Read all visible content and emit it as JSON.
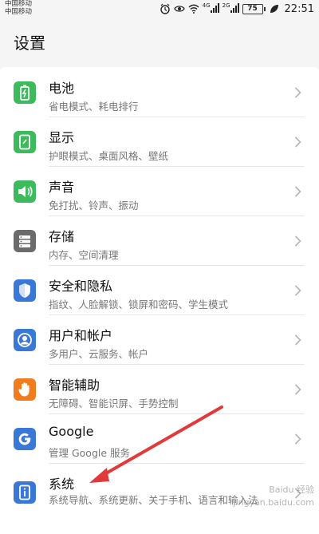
{
  "status_bar": {
    "carrier_1": "中国移动",
    "carrier_2": "中国移动",
    "signal_1_label": "4G",
    "signal_2_label": "2G",
    "battery": "75",
    "time": "22:51"
  },
  "page_title": "设置",
  "items": [
    {
      "title": "电池",
      "subtitle": "省电模式、耗电排行",
      "icon": "battery-icon",
      "color": "#3dbb5c"
    },
    {
      "title": "显示",
      "subtitle": "护眼模式、桌面风格、壁纸",
      "icon": "display-icon",
      "color": "#3dbb5c"
    },
    {
      "title": "声音",
      "subtitle": "免打扰、铃声、振动",
      "icon": "sound-icon",
      "color": "#3dbb5c"
    },
    {
      "title": "存储",
      "subtitle": "内存、空间清理",
      "icon": "storage-icon",
      "color": "#6b6b6b"
    },
    {
      "title": "安全和隐私",
      "subtitle": "指纹、人脸解锁、锁屏和密码、学生模式",
      "icon": "shield-icon",
      "color": "#3a78d8"
    },
    {
      "title": "用户和帐户",
      "subtitle": "多用户、云服务、帐户",
      "icon": "user-icon",
      "color": "#3a78d8"
    },
    {
      "title": "智能辅助",
      "subtitle": "无障碍、智能识屏、手势控制",
      "icon": "hand-icon",
      "color": "#f07c1e"
    },
    {
      "title": "Google",
      "subtitle": "管理 Google 服务",
      "icon": "google-icon",
      "color": "#3a78d8"
    },
    {
      "title": "系统",
      "subtitle": "系统导航、系统更新、关于手机、语言和输入法",
      "icon": "system-info-icon",
      "color": "#3a78d8"
    }
  ],
  "watermark": {
    "line1": "Baidu 经验",
    "line2": "jingyan.baidu.com"
  },
  "colors": {
    "annotation_arrow": "#e03a3a"
  }
}
